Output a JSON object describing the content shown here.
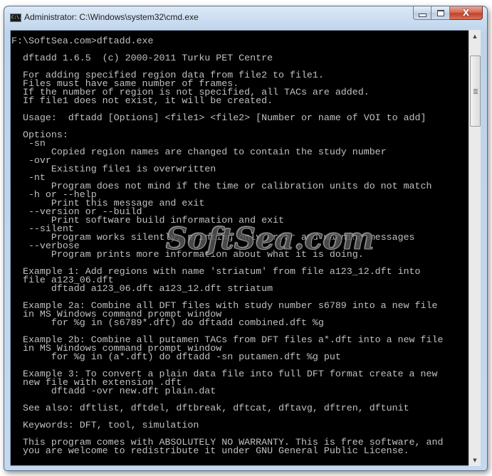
{
  "window": {
    "title": "Administrator: C:\\Windows\\system32\\cmd.exe",
    "icon": "cmd-icon",
    "icon_text": "C:\\.",
    "controls": {
      "minimize": "minimize-icon",
      "maximize": "maximize-icon",
      "close": "close-icon",
      "close_glyph": "X"
    }
  },
  "console": {
    "lines": [
      "F:\\SoftSea.com>dftadd.exe",
      "",
      "  dftadd 1.6.5  (c) 2000-2011 Turku PET Centre",
      "",
      "  For adding specified region data from file2 to file1.",
      "  Files must have same number of frames.",
      "  If the number of region is not specified, all TACs are added.",
      "  If file1 does not exist, it will be created.",
      "",
      "  Usage:  dftadd [Options] <file1> <file2> [Number or name of VOI to add]",
      "",
      "  Options:",
      "   -sn",
      "       Copied region names are changed to contain the study number",
      "   -ovr",
      "       Existing file1 is overwritten",
      "   -nt",
      "       Program does not mind if the time or calibration units do not match",
      "   -h or --help",
      "       Print this message and exit",
      "   --version or --build",
      "       Print software build information and exit",
      "   --silent",
      "       Program works silently, printing only error and warning messages",
      "   --verbose",
      "       Program prints more information about what it is doing.",
      "",
      "  Example 1: Add regions with name 'striatum' from file a123_12.dft into",
      "  file a123_06.dft",
      "       dftadd a123_06.dft a123_12.dft striatum",
      "",
      "  Example 2a: Combine all DFT files with study number s6789 into a new file",
      "  in MS Windows command prompt window",
      "       for %g in (s6789*.dft) do dftadd combined.dft %g",
      "",
      "  Example 2b: Combine all putamen TACs from DFT files a*.dft into a new file",
      "  in MS Windows command prompt window",
      "       for %g in (a*.dft) do dftadd -sn putamen.dft %g put",
      "",
      "  Example 3: To convert a plain data file into full DFT format create a new",
      "  new file with extension .dft",
      "       dftadd -ovr new.dft plain.dat",
      "",
      "  See also: dftlist, dftdel, dftbreak, dftcat, dftavg, dftren, dftunit",
      "",
      "  Keywords: DFT, tool, simulation",
      "",
      "  This program comes with ABSOLUTELY NO WARRANTY. This is free software, and",
      "  you are welcome to redistribute it under GNU General Public License."
    ],
    "text_color": "#c0c0c0",
    "background_color": "#000000"
  },
  "watermark": {
    "text": "SoftSea.com"
  },
  "scrollbar": {
    "up_glyph": "▲",
    "down_glyph": "▼"
  }
}
